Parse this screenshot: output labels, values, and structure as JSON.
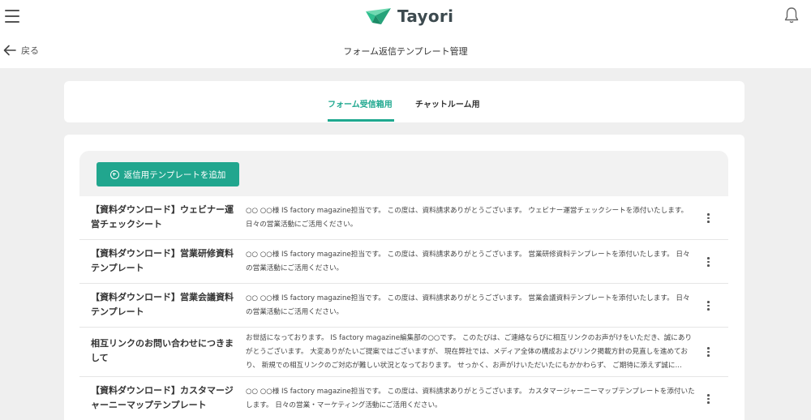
{
  "header": {
    "logo_text": "Tayori",
    "back_label": "戻る",
    "page_title": "フォーム返信テンプレート管理",
    "icons": [
      "menu-icon",
      "logo-mark-icon",
      "bell-icon",
      "arrow-left-icon"
    ]
  },
  "tabs": [
    {
      "label": "フォーム受信箱用",
      "active": true
    },
    {
      "label": "チャットルーム用",
      "active": false
    }
  ],
  "add_button": {
    "label": "返信用テンプレートを追加",
    "icon": "plus-circle-icon"
  },
  "colors": {
    "accent": "#21a68e",
    "logo_green": "#2fbf8f",
    "background": "#efefef"
  },
  "templates": [
    {
      "title": "【資料ダウンロード】ウェビナー運営チェックシート",
      "body": "○○ ○○様 IS factory magazine担当です。 この度は、資料請求ありがとうございます。 ウェビナー運営チェックシートを添付いたします。 日々の営業活動にご活用ください。"
    },
    {
      "title": "【資料ダウンロード】営業研修資料テンプレート",
      "body": "○○ ○○様 IS factory magazine担当です。 この度は、資料請求ありがとうございます。 営業研修資料テンプレートを添付いたします。 日々の営業活動にご活用ください。"
    },
    {
      "title": "【資料ダウンロード】営業会議資料テンプレート",
      "body": "○○ ○○様 IS factory magazine担当です。 この度は、資料請求ありがとうございます。 営業会議資料テンプレートを添付いたします。 日々の営業活動にご活用ください。"
    },
    {
      "title": "相互リンクのお問い合わせにつきまして",
      "body": "お世話になっております。 IS factory magazine編集部の○○です。 このたびは、ご連絡ならびに相互リンクのお声がけをいただき、誠にありがとうございます。 大変ありがたいご提案ではございますが、 現在弊社では、メディア全体の構成およびリンク掲載方針の見直しを進めており、 新規での相互リンクのご対応が難しい状況となっております。 せっかく、お声がけいただいたにもかかわらず、 ご期待に添えず誠に..."
    },
    {
      "title": "【資料ダウンロード】カスタマージャーニーマップテンプレート",
      "body": "○○ ○○様 IS factory magazine担当です。 この度は、資料請求ありがとうございます。 カスタマージャーニーマップテンプレートを添付いたします。 日々の営業・マーケティング活動にご活用ください。"
    }
  ]
}
